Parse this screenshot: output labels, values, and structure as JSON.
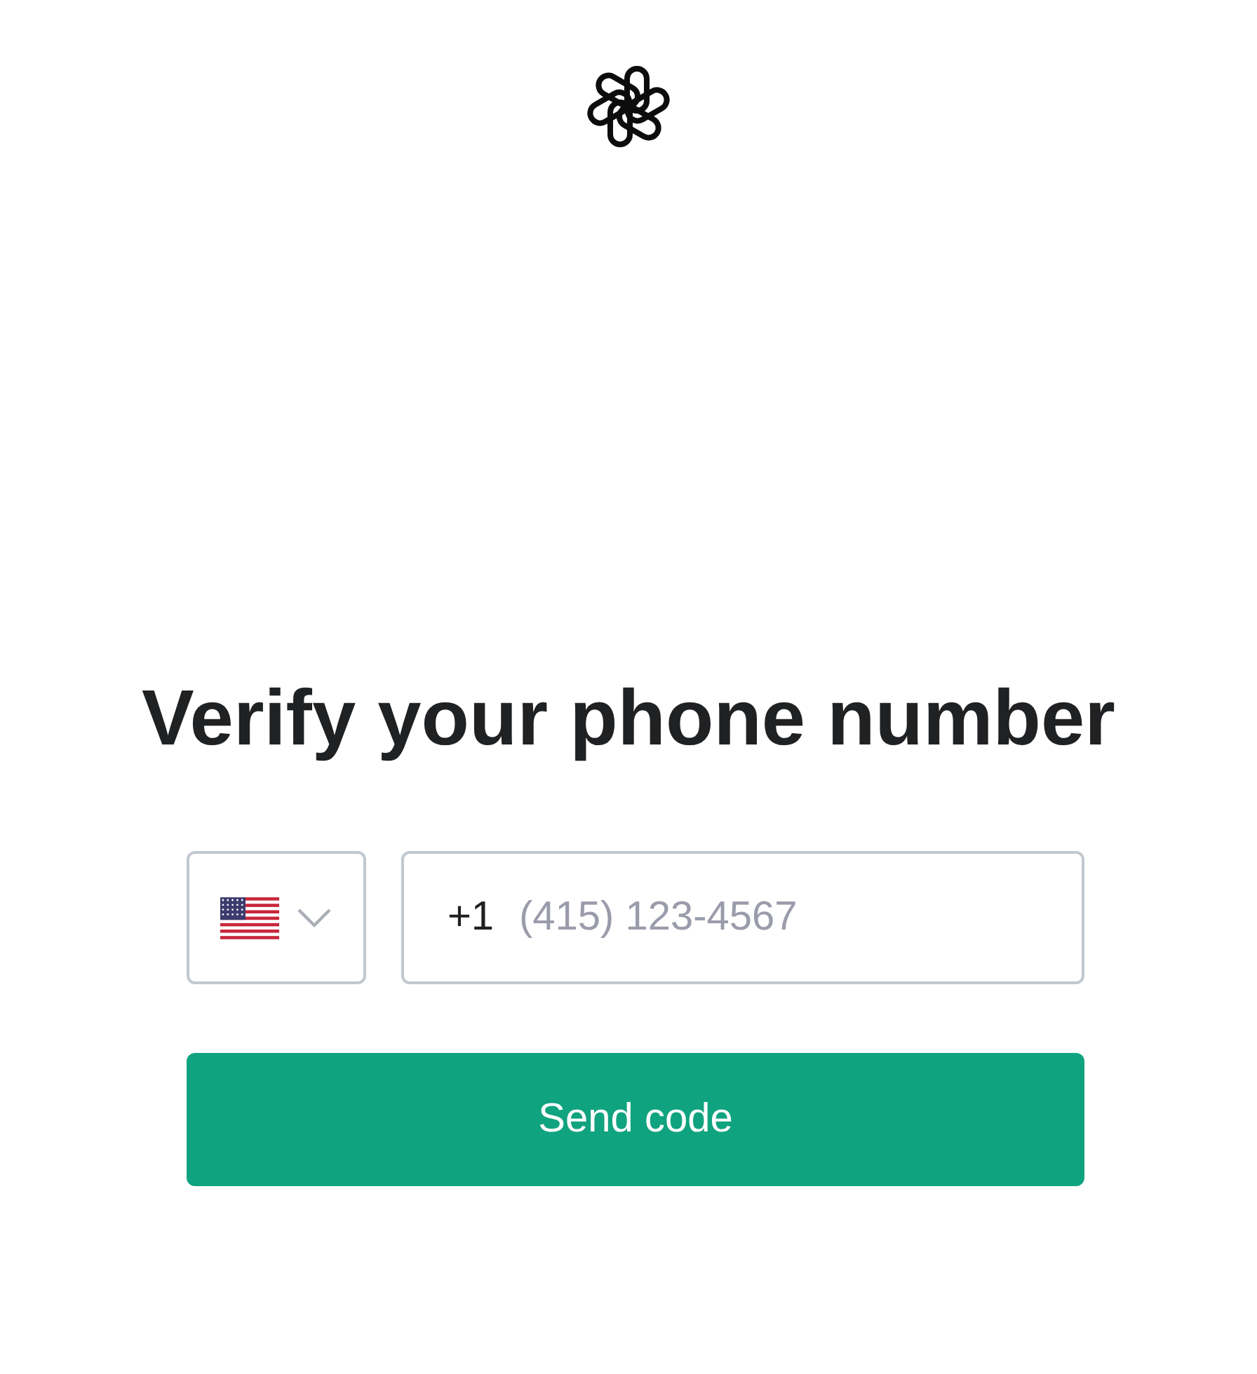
{
  "heading": "Verify your phone number",
  "phone_field": {
    "prefix": "+1",
    "placeholder": "(415) 123-4567"
  },
  "buttons": [
    "Send code"
  ]
}
